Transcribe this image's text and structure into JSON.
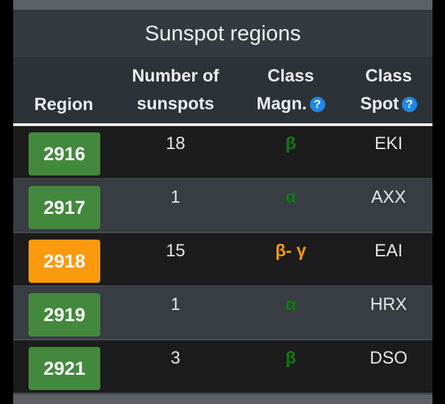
{
  "title": "Sunspot regions",
  "headers": {
    "region": "Region",
    "num_line1": "Number of",
    "num_line2": "sunspots",
    "magn_line1": "Class",
    "magn_line2": "Magn.",
    "spot_line1": "Class",
    "spot_line2": "Spot",
    "help_glyph": "?"
  },
  "rows": [
    {
      "region": "2916",
      "count": "18",
      "magn": "β",
      "spot": "EKI"
    },
    {
      "region": "2917",
      "count": "1",
      "magn": "α",
      "spot": "AXX"
    },
    {
      "region": "2918",
      "count": "15",
      "magn": "β- γ",
      "spot": "EAI"
    },
    {
      "region": "2919",
      "count": "1",
      "magn": "α",
      "spot": "HRX"
    },
    {
      "region": "2921",
      "count": "3",
      "magn": "β",
      "spot": "DSO"
    }
  ],
  "colors": {
    "badge_green": "#43893d",
    "badge_orange": "#fb9a0c",
    "magn_green": "#137a12",
    "magn_orange": "#f59d0b",
    "help_blue": "#1e88e5"
  }
}
